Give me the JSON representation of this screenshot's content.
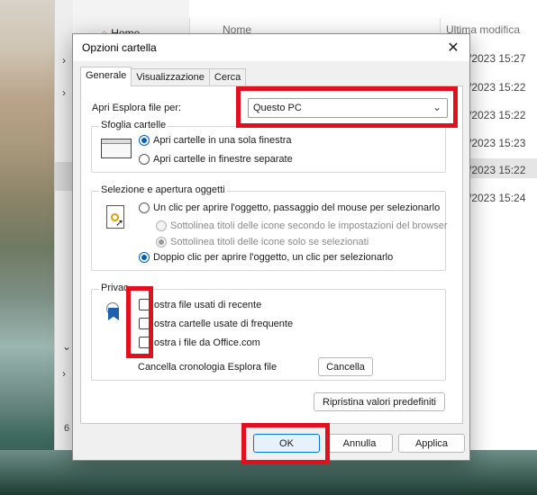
{
  "explorer": {
    "nav_home": "Home",
    "col_name": "Nome",
    "col_modified": "Ultima modifica",
    "dates": [
      "/2023 15:27",
      "/2023 15:22",
      "/2023 15:22",
      "/2023 15:23",
      "/2023 15:22",
      "/2023 15:24"
    ],
    "status_count": "6"
  },
  "dialog": {
    "title": "Opzioni cartella",
    "tabs": [
      "Generale",
      "Visualizzazione",
      "Cerca"
    ],
    "open_explorer_label": "Apri Esplora file per:",
    "open_explorer_value": "Questo PC",
    "browse_group": {
      "title": "Sfoglia cartelle",
      "options": [
        "Apri cartelle in una sola finestra",
        "Apri cartelle in finestre separate"
      ],
      "selected": 0
    },
    "click_group": {
      "title": "Selezione e apertura oggetti",
      "single_click": "Un clic per aprire l'oggetto, passaggio del mouse per selezionarlo",
      "sub_underline_always": "Sottolinea titoli delle icone secondo le impostazioni del browser",
      "sub_underline_hover": "Sottolinea titoli delle icone solo se selezionati",
      "double_click": "Doppio clic per aprire l'oggetto, un clic per selezionarlo",
      "selected": "double_click"
    },
    "privacy_group": {
      "title": "Privac",
      "checkboxes": [
        "ostra file usati di recente",
        "ostra cartelle usate di frequente",
        "ostra i file da Office.com"
      ],
      "clear_label": "Cancella cronologia Esplora file",
      "clear_button": "Cancella"
    },
    "restore_button": "Ripristina valori predefiniti",
    "ok_button": "OK",
    "cancel_button": "Annulla",
    "apply_button": "Applica"
  },
  "colors": {
    "accent": "#005fb8",
    "highlight_box": "#e0101c"
  }
}
